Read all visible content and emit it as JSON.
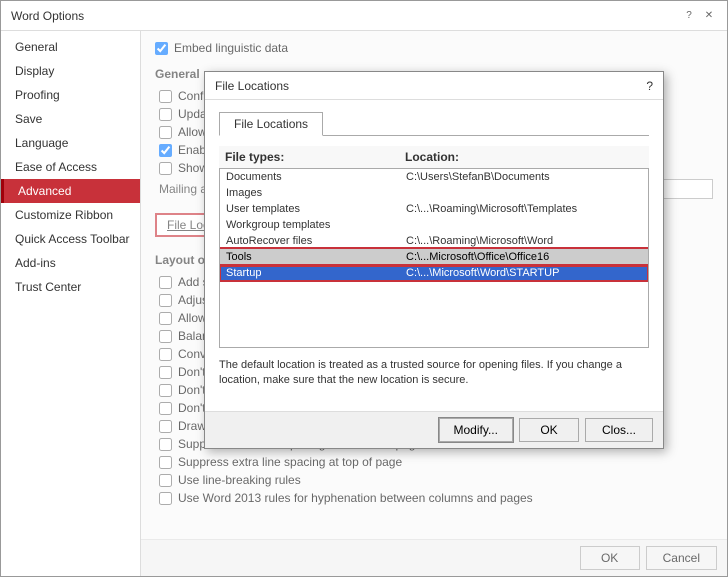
{
  "window": {
    "title": "Word Options",
    "help_icon": "?",
    "close_icon": "✕"
  },
  "sidebar": {
    "items": [
      {
        "id": "general",
        "label": "General"
      },
      {
        "id": "display",
        "label": "Display"
      },
      {
        "id": "proofing",
        "label": "Proofing"
      },
      {
        "id": "save",
        "label": "Save"
      },
      {
        "id": "language",
        "label": "Language"
      },
      {
        "id": "ease-of-access",
        "label": "Ease of Access"
      },
      {
        "id": "advanced",
        "label": "Advanced",
        "active": true
      },
      {
        "id": "customize-ribbon",
        "label": "Customize Ribbon"
      },
      {
        "id": "quick-access",
        "label": "Quick Access Toolbar"
      },
      {
        "id": "addins",
        "label": "Add-ins"
      },
      {
        "id": "trust-center",
        "label": "Trust Center"
      }
    ]
  },
  "main": {
    "embed_linguistic_label": "Embed linguistic data",
    "general_section": "General",
    "checkboxes": [
      {
        "id": "confirm",
        "label": "Confirm file form..."
      },
      {
        "id": "update",
        "label": "Update automati..."
      },
      {
        "id": "allow-opening",
        "label": "Allow opening a..."
      },
      {
        "id": "enable-background",
        "label": "Enable backgrou...",
        "checked": true
      },
      {
        "id": "show-addins",
        "label": "Show add-in use..."
      }
    ],
    "mailing_label": "Mailing address:",
    "file_locations_btn": "File Locations...",
    "layout_section": "Layout options for:",
    "layout_checkboxes": [
      {
        "id": "add-space",
        "label": "Add space for ur..."
      },
      {
        "id": "adjust-line",
        "label": "Adjust line heigh..."
      },
      {
        "id": "allow-hyphen",
        "label": "Allow hyphenati..."
      },
      {
        "id": "balance-sbcs",
        "label": "Balance SBCS ch..."
      },
      {
        "id": "convert-backslash",
        "label": "Convert backslash..."
      },
      {
        "id": "dont-center",
        "label": "Don't center \"ex..."
      },
      {
        "id": "dont-expand",
        "label": "Don't expand ch..."
      },
      {
        "id": "dont-use-html",
        "label": "Don't use HTML paragraph auto spacing"
      },
      {
        "id": "draw-underline",
        "label": "Draw underline on trailing spaces"
      },
      {
        "id": "suppress-extra-bottom",
        "label": "Suppress extra line spacing at bottom of page"
      },
      {
        "id": "suppress-extra-top",
        "label": "Suppress extra line spacing at top of page"
      },
      {
        "id": "use-line-breaking",
        "label": "Use line-breaking rules"
      },
      {
        "id": "use-word2013",
        "label": "Use Word 2013 rules for hyphenation between columns and pages"
      }
    ],
    "footer": {
      "ok_label": "OK",
      "cancel_label": "Cancel"
    }
  },
  "dialog": {
    "title": "File Locations",
    "help_icon": "?",
    "tab_label": "File Locations",
    "columns": {
      "type_header": "File types:",
      "location_header": "Location:"
    },
    "file_rows": [
      {
        "id": "documents",
        "type": "Documents",
        "location": "C:\\Users\\StefanB\\Documents",
        "selected": false
      },
      {
        "id": "images",
        "type": "Images",
        "location": "",
        "selected": false
      },
      {
        "id": "user-templates",
        "type": "User templates",
        "location": "C:\\...\\Roaming\\Microsoft\\Templates",
        "selected": false
      },
      {
        "id": "workgroup-templates",
        "type": "Workgroup templates",
        "location": "",
        "selected": false
      },
      {
        "id": "autorecover",
        "type": "AutoRecover files",
        "location": "C:\\...\\Roaming\\Microsoft\\Word",
        "selected": false
      },
      {
        "id": "tools",
        "type": "Tools",
        "location": "C:\\...Microsoft\\Office\\Office16",
        "selected": false,
        "highlight": true
      },
      {
        "id": "startup",
        "type": "Startup",
        "location": "C:\\...\\Microsoft\\Word\\STARTUP",
        "selected": true,
        "highlight": true
      }
    ],
    "note": "The default location is treated as a trusted source for opening files. If you change a location, make sure that the new location is secure.",
    "modify_btn": "Modify...",
    "ok_label": "OK",
    "close_label": "Clos..."
  }
}
